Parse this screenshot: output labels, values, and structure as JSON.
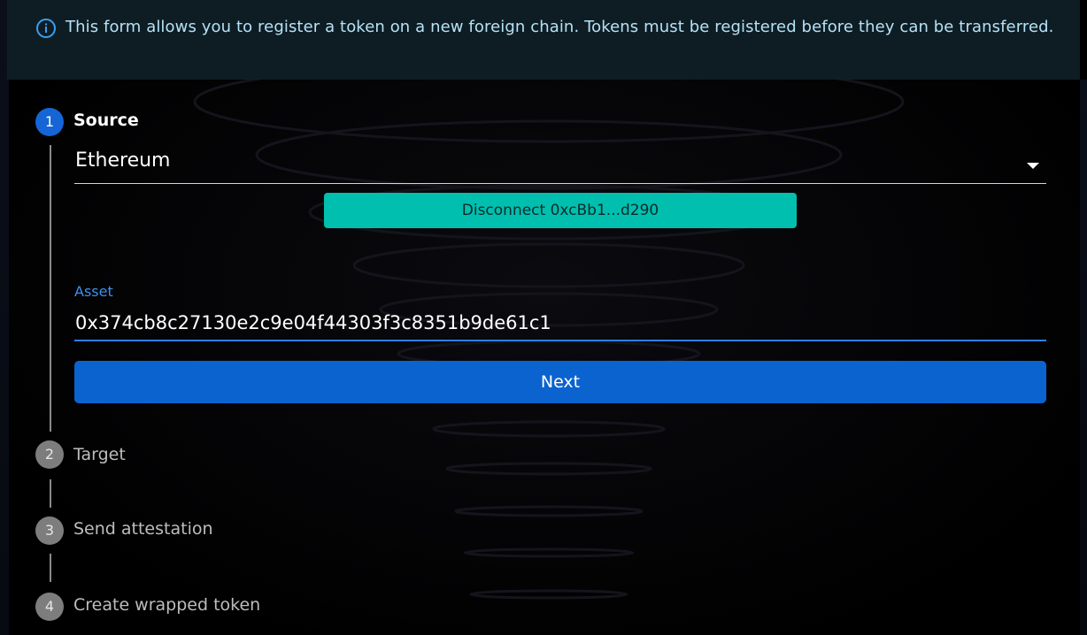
{
  "alert": {
    "icon": "info-icon",
    "message": "This form allows you to register a token on a new foreign chain. Tokens must be registered before they can be transferred."
  },
  "steps": [
    {
      "number": "1",
      "label": "Source",
      "state": "active"
    },
    {
      "number": "2",
      "label": "Target",
      "state": "inactive"
    },
    {
      "number": "3",
      "label": "Send attestation",
      "state": "inactive"
    },
    {
      "number": "4",
      "label": "Create wrapped token",
      "state": "inactive"
    }
  ],
  "source": {
    "chain_selected": "Ethereum",
    "disconnect_label": "Disconnect 0xcBb1...d290",
    "asset_label": "Asset",
    "asset_value": "0x374cb8c27130e2c9e04f44303f3c8351b9de61c1",
    "next_label": "Next"
  },
  "colors": {
    "accent": "#0b63cf",
    "teal": "#00bfae",
    "alert_bg": "#0e1c24"
  }
}
